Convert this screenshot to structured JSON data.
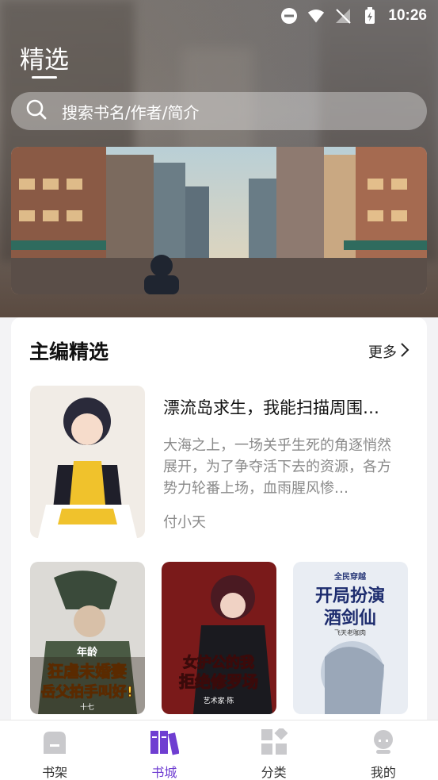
{
  "status_bar": {
    "time": "10:26"
  },
  "header": {
    "title": "精选"
  },
  "search": {
    "placeholder": "搜索书名/作者/简介"
  },
  "section": {
    "title": "主编精选",
    "more_label": "更多",
    "featured": {
      "title": "漂流岛求生，我能扫描周围…",
      "description": "大海之上，一场关乎生死的角逐悄然展开，为了争夺活下去的资源，各方势力轮番上场，血雨腥风惨…",
      "author": "付小天"
    },
    "covers": [
      {
        "title_text": "年龄 狂虐未婚妻 岳父拍手叫好！",
        "author": "十七"
      },
      {
        "title_text": "女护公的我 拒绝修罗场",
        "author": "艺术家·陈"
      },
      {
        "title_text": "全民穿越 开局扮演酒剑仙",
        "author": "飞天老咖肉"
      }
    ]
  },
  "tabbar": {
    "tabs": [
      {
        "label": "书架"
      },
      {
        "label": "书城"
      },
      {
        "label": "分类"
      },
      {
        "label": "我的"
      }
    ],
    "active_index": 1
  },
  "colors": {
    "accent": "#6f3ed1"
  }
}
